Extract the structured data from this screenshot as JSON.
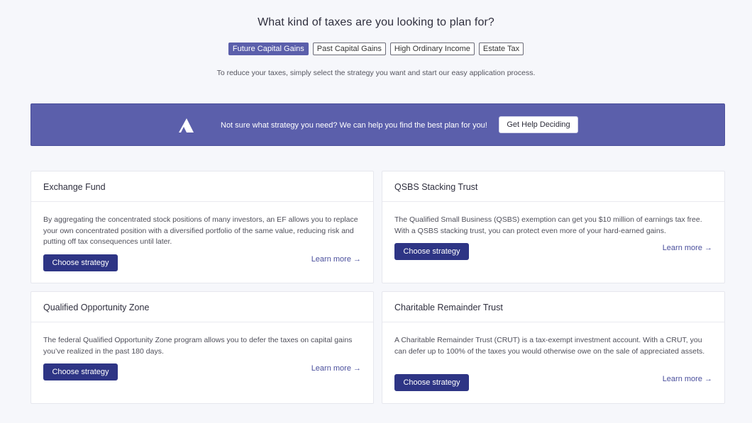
{
  "header": {
    "title": "What kind of taxes are you looking to plan for?",
    "subtitle": "To reduce your taxes, simply select the strategy you want and start our easy application process."
  },
  "filters": [
    {
      "label": "Future Capital Gains",
      "active": true
    },
    {
      "label": "Past Capital Gains",
      "active": false
    },
    {
      "label": "High Ordinary Income",
      "active": false
    },
    {
      "label": "Estate Tax",
      "active": false
    }
  ],
  "banner": {
    "icon": "mountain-icon",
    "text": "Not sure what strategy you need? We can help you find the best plan for you!",
    "button": "Get Help Deciding"
  },
  "cards": [
    {
      "title": "Exchange Fund",
      "description": "By aggregating the concentrated stock positions of many investors, an EF allows you to replace your own concentrated position with a diversified portfolio of the same value, reducing risk and putting off tax consequences until later.",
      "button": "Choose strategy",
      "link": "Learn more →"
    },
    {
      "title": "QSBS Stacking Trust",
      "description": "The Qualified Small Business (QSBS) exemption can get you $10 million of earnings tax free. With a QSBS stacking trust, you can protect even more of your hard-earned gains.",
      "button": "Choose strategy",
      "link": "Learn more →"
    },
    {
      "title": "Qualified Opportunity Zone",
      "description": "The federal Qualified Opportunity Zone program allows you to defer the taxes on capital gains you’ve realized in the past 180 days.",
      "button": "Choose strategy",
      "link": "Learn more →"
    },
    {
      "title": "Charitable Remainder Trust",
      "description": "A Charitable Remainder Trust (CRUT) is a tax-exempt investment account. With a CRUT, you can defer up to 100% of the taxes you would otherwise owe on the sale of appreciated assets.",
      "button": "Choose strategy",
      "link": "Learn more →"
    }
  ],
  "colors": {
    "accent": "#5b5fab",
    "button": "#2e3585",
    "background": "#f6f7fb"
  }
}
